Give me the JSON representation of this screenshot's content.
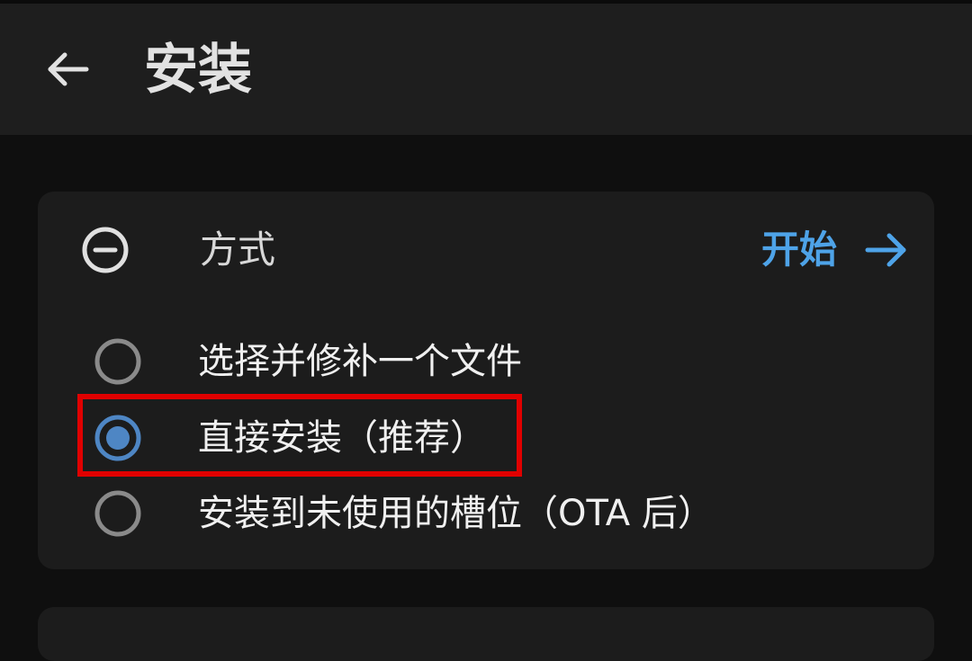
{
  "appbar": {
    "back_icon": "arrow-left-icon",
    "title": "安装"
  },
  "method_card": {
    "collapse_icon": "minus-circle-icon",
    "label": "方式",
    "start_label": "开始",
    "start_icon": "arrow-right-icon",
    "accent_color": "#4ea3e8",
    "options": [
      {
        "label": "选择并修补一个文件",
        "selected": false
      },
      {
        "label": "直接安装（推荐）",
        "selected": true
      },
      {
        "label": "安装到未使用的槽位（OTA 后）",
        "selected": false
      }
    ]
  },
  "annotation": {
    "highlight_color": "#e00000"
  }
}
